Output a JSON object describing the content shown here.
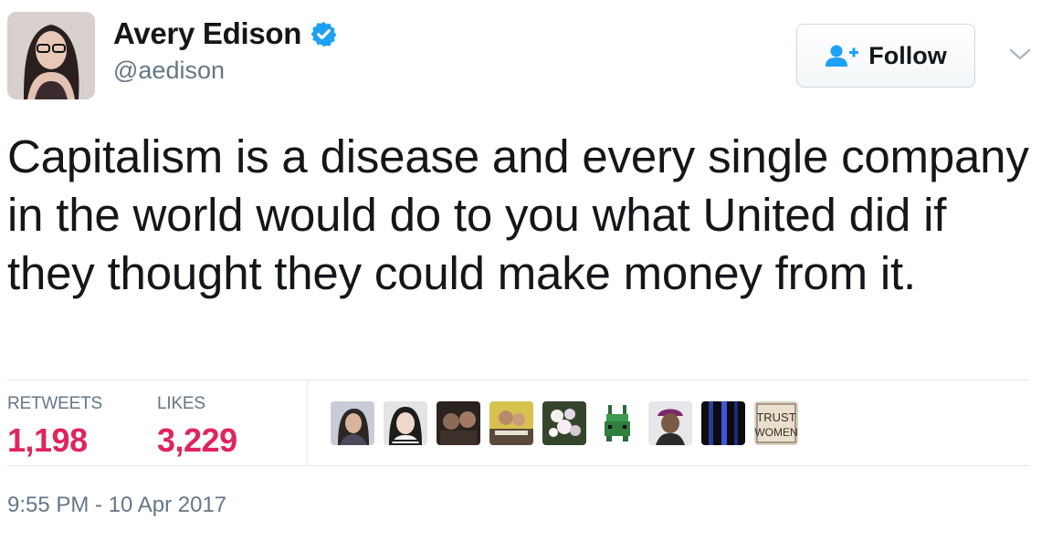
{
  "author": {
    "name": "Avery Edison",
    "handle": "@aedison",
    "verified": true,
    "verified_color": "#1da1f2"
  },
  "follow_button": {
    "label": "Follow",
    "icon": "follow-person-plus-icon",
    "icon_color": "#1da1f2"
  },
  "menu": {
    "icon": "chevron-down-icon"
  },
  "tweet": {
    "text": "Capitalism is a disease and every single company in the world would do to you what United did if they thought they could make money from it."
  },
  "stats": {
    "retweets_label": "RETWEETS",
    "retweets_value": "1,198",
    "likes_label": "LIKES",
    "likes_value": "3,229",
    "value_color": "#e0245e"
  },
  "likers": [
    {
      "icon": "liker-avatar-1"
    },
    {
      "icon": "liker-avatar-2"
    },
    {
      "icon": "liker-avatar-3"
    },
    {
      "icon": "liker-avatar-4"
    },
    {
      "icon": "liker-avatar-5"
    },
    {
      "icon": "liker-avatar-6"
    },
    {
      "icon": "liker-avatar-7"
    },
    {
      "icon": "liker-avatar-8"
    },
    {
      "icon": "liker-avatar-9",
      "sign_text": "TRUST WOMEN"
    }
  ],
  "timestamp": "9:55 PM - 10 Apr 2017"
}
